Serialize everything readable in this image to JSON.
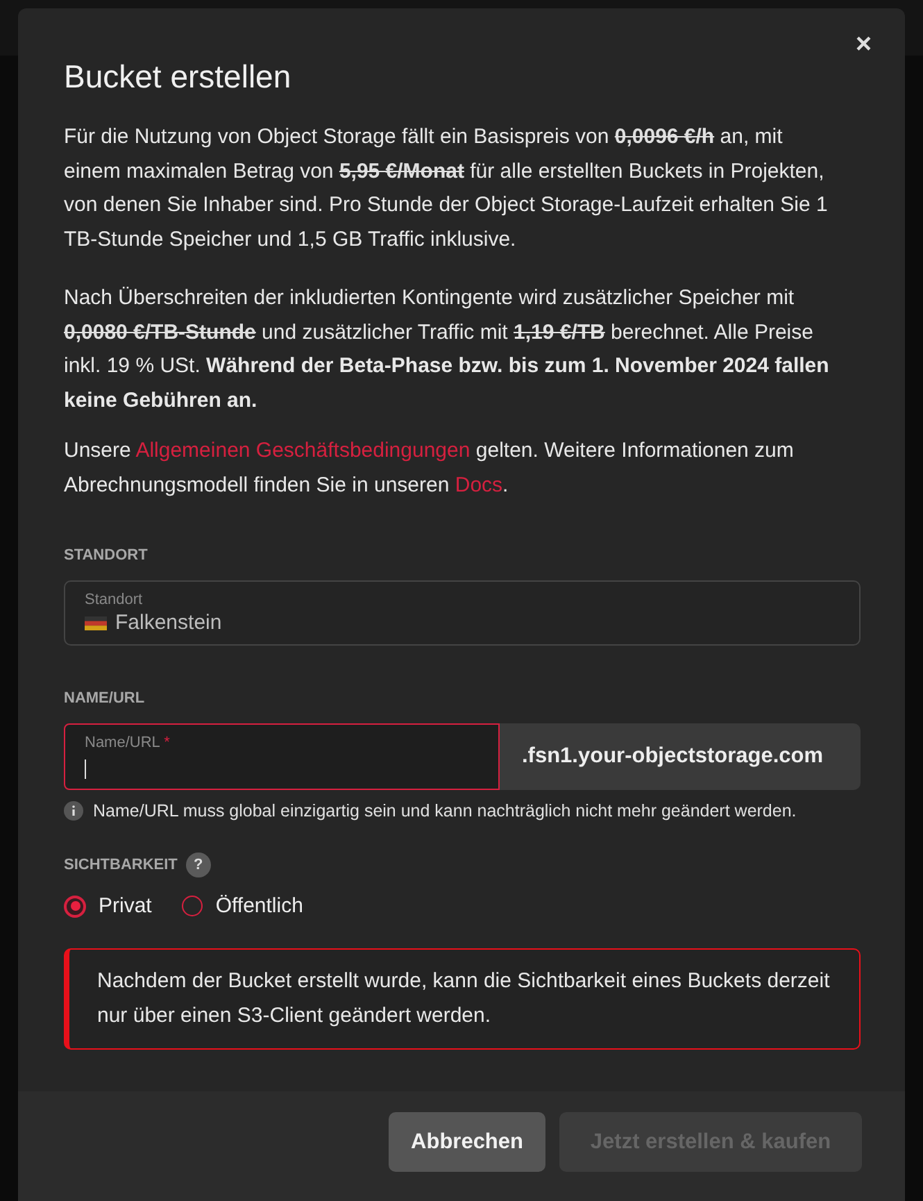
{
  "dialog": {
    "title": "Bucket erstellen",
    "close": "×"
  },
  "paragraphs": [
    [
      {
        "kind": "plain",
        "text": "Für die Nutzung von Object Storage fällt ein Basispreis von "
      },
      {
        "kind": "strike",
        "text": "0,0096 €/h"
      },
      {
        "kind": "plain",
        "text": " an, mit einem maximalen Betrag von "
      },
      {
        "kind": "strike",
        "text": "5,95 €/Monat"
      },
      {
        "kind": "plain",
        "text": " für alle erstellten Buckets in Projekten, von denen Sie Inhaber sind. Pro Stunde der Object Storage-Laufzeit erhalten Sie 1 TB-Stunde Speicher und 1,5 GB Traffic inklusive."
      }
    ],
    [
      {
        "kind": "plain",
        "text": "Nach Überschreiten der inkludierten Kontingente wird zusätzlicher Speicher mit "
      },
      {
        "kind": "strike",
        "text": "0,0080 €/TB-Stunde"
      },
      {
        "kind": "plain",
        "text": " und zusätzlicher Traffic mit "
      },
      {
        "kind": "strike",
        "text": "1,19 €/TB"
      },
      {
        "kind": "plain",
        "text": " berechnet. Alle Preise inkl. 19 % USt. "
      },
      {
        "kind": "bold",
        "text": "Während der Beta-Phase bzw. bis zum 1. November 2024 fallen keine Gebühren an."
      }
    ],
    [
      {
        "kind": "plain",
        "text": "Unsere "
      },
      {
        "kind": "link",
        "text": "Allgemeinen Geschäftsbedingungen"
      },
      {
        "kind": "plain",
        "text": " gelten. Weitere Informationen zum Abrechnungsmodell finden Sie in unseren "
      },
      {
        "kind": "link",
        "text": "Docs"
      },
      {
        "kind": "plain",
        "text": "."
      }
    ]
  ],
  "location": {
    "section": "STANDORT",
    "label": "Standort",
    "value": "Falkenstein"
  },
  "name_url": {
    "section": "NAME/URL",
    "label": "Name/URL",
    "required_mark": "*",
    "invalid": true,
    "suffix": ".fsn1.your-objectstorage.com",
    "hint": "Name/URL muss global einzigartig sein und kann nachträglich nicht mehr geändert werden."
  },
  "visibility": {
    "section": "SICHTBARKEIT",
    "help": "?",
    "options": [
      {
        "label": "Privat",
        "selected": true
      },
      {
        "label": "Öffentlich",
        "selected": false
      }
    ]
  },
  "notice": "Nachdem der Bucket erstellt wurde, kann die Sichtbarkeit eines Buckets derzeit nur über einen S3-Client geändert werden.",
  "buttons": [
    {
      "label": "Abbrechen",
      "disabled": false
    },
    {
      "label": "Jetzt erstellen & kaufen",
      "disabled": true
    }
  ]
}
